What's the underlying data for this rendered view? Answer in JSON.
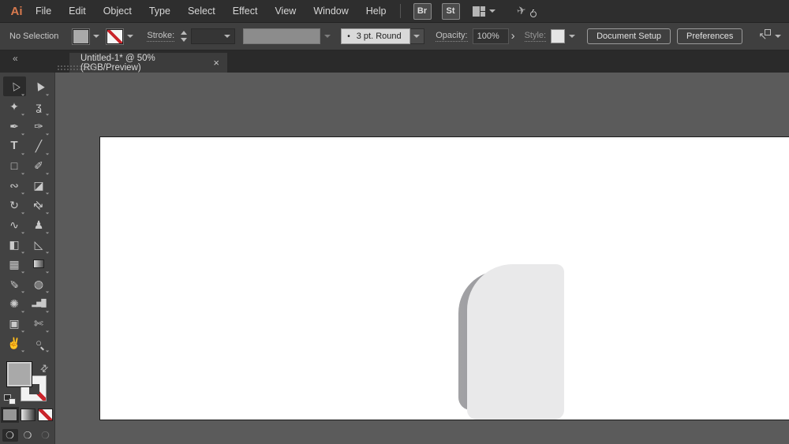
{
  "menu_bar": {
    "logo": "Ai",
    "items": [
      "File",
      "Edit",
      "Object",
      "Type",
      "Select",
      "Effect",
      "View",
      "Window",
      "Help"
    ],
    "bridge_label": "Br",
    "stock_label": "St",
    "icons": [
      "workspace-switcher-icon",
      "share-sync-icon"
    ]
  },
  "control_bar": {
    "selection_status": "No Selection",
    "fill_swatch_color": "#a9a9a9",
    "stroke_swatch": "none",
    "stroke_label": "Stroke:",
    "brush_bullet": "•",
    "brush_value": "3 pt. Round",
    "opacity_label": "Opacity:",
    "opacity_value": "100%",
    "style_label": "Style:",
    "document_setup_label": "Document Setup",
    "preferences_label": "Preferences",
    "icons": [
      "fill-color-swatch",
      "stroke-color-swatch",
      "stroke-weight-stepper",
      "variable-width-profile",
      "select-similar-icon"
    ]
  },
  "tab_bar": {
    "collapse_glyph": "«",
    "title": "Untitled-1* @ 50% (RGB/Preview)",
    "close_glyph": "×"
  },
  "toolbar": {
    "tools": [
      {
        "name": "selection",
        "glyph": "▷",
        "selected": true
      },
      {
        "name": "direct-selection",
        "glyph": "▶",
        "selected": false
      },
      {
        "name": "magic-wand",
        "glyph": "✦",
        "selected": false
      },
      {
        "name": "lasso",
        "glyph": "ʓ",
        "selected": false
      },
      {
        "name": "pen",
        "glyph": "✒",
        "selected": false
      },
      {
        "name": "curvature",
        "glyph": "✑",
        "selected": false
      },
      {
        "name": "type",
        "glyph": "T",
        "selected": false
      },
      {
        "name": "line-segment",
        "glyph": "╱",
        "selected": false
      },
      {
        "name": "rectangle",
        "glyph": "□",
        "selected": false
      },
      {
        "name": "paintbrush",
        "glyph": "✐",
        "selected": false
      },
      {
        "name": "shaper",
        "glyph": "∾",
        "selected": false
      },
      {
        "name": "eraser",
        "glyph": "◪",
        "selected": false
      },
      {
        "name": "rotate",
        "glyph": "↻",
        "selected": false
      },
      {
        "name": "scale",
        "glyph": "⇄",
        "selected": false
      },
      {
        "name": "width",
        "glyph": "∿",
        "selected": false
      },
      {
        "name": "puppet-warp",
        "glyph": "♟",
        "selected": false
      },
      {
        "name": "shape-builder",
        "glyph": "◧",
        "selected": false
      },
      {
        "name": "perspective-grid",
        "glyph": "◺",
        "selected": false
      },
      {
        "name": "mesh",
        "glyph": "▦",
        "selected": false
      },
      {
        "name": "gradient",
        "glyph": "",
        "selected": false
      },
      {
        "name": "eyedropper",
        "glyph": "✎",
        "selected": false
      },
      {
        "name": "blend",
        "glyph": "◍",
        "selected": false
      },
      {
        "name": "symbol-sprayer",
        "glyph": "✺",
        "selected": false
      },
      {
        "name": "column-graph",
        "glyph": "▂▅█",
        "selected": false
      },
      {
        "name": "artboard",
        "glyph": "▣",
        "selected": false
      },
      {
        "name": "slice",
        "glyph": "✄",
        "selected": false
      },
      {
        "name": "hand",
        "glyph": "✌",
        "selected": false
      },
      {
        "name": "zoom",
        "glyph": "○",
        "selected": false
      }
    ],
    "fill_color": "#a9a9a9",
    "stroke_color": "none",
    "swap_glyph": "⇄",
    "mode_glyph": "❍"
  },
  "canvas": {
    "artboard_color": "#ffffff",
    "workspace_color": "#5b5b5b",
    "shape_fill": "#e9e9ea",
    "shape_shadow_fill": "#939396"
  },
  "glyphs": {
    "plane": "✈",
    "select_similar": "↖",
    "opacity_expander": "›"
  },
  "colors": {
    "menu_bg": "#2e2e2e",
    "control_bg": "#3f3f3f",
    "panel_bg": "#424242",
    "accent_logo": "#d97a4e",
    "none_red": "#c9242b"
  }
}
